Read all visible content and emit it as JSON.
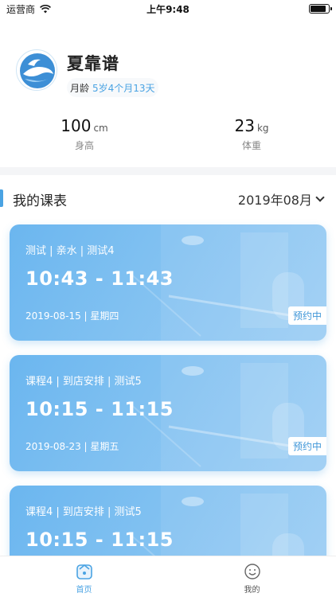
{
  "status_bar": {
    "carrier": "运营商",
    "time": "上午9:48"
  },
  "profile": {
    "name": "夏靠谱",
    "age_label": "月龄",
    "age_value": "5岁4个月13天"
  },
  "metrics": {
    "height": {
      "value": "100",
      "unit": "cm",
      "label": "身高"
    },
    "weight": {
      "value": "23",
      "unit": "kg",
      "label": "体重"
    }
  },
  "schedule": {
    "title": "我的课表",
    "month": "2019年08月"
  },
  "cards": [
    {
      "meta": "测试 | 亲水 | 测试4",
      "time": "10:43 - 11:43",
      "date": "2019-08-15 | 星期四",
      "status": "预约中"
    },
    {
      "meta": "课程4 | 到店安排 | 测试5",
      "time": "10:15 - 11:15",
      "date": "2019-08-23 | 星期五",
      "status": "预约中"
    },
    {
      "meta": "课程4 | 到店安排 | 测试5",
      "time": "10:15 - 11:15",
      "date": "",
      "status": ""
    }
  ],
  "tabbar": {
    "home": "首页",
    "mine": "我的"
  },
  "colors": {
    "accent": "#4aa3e3",
    "card_start": "#6bb6ef",
    "card_end": "#9ccdf3"
  }
}
